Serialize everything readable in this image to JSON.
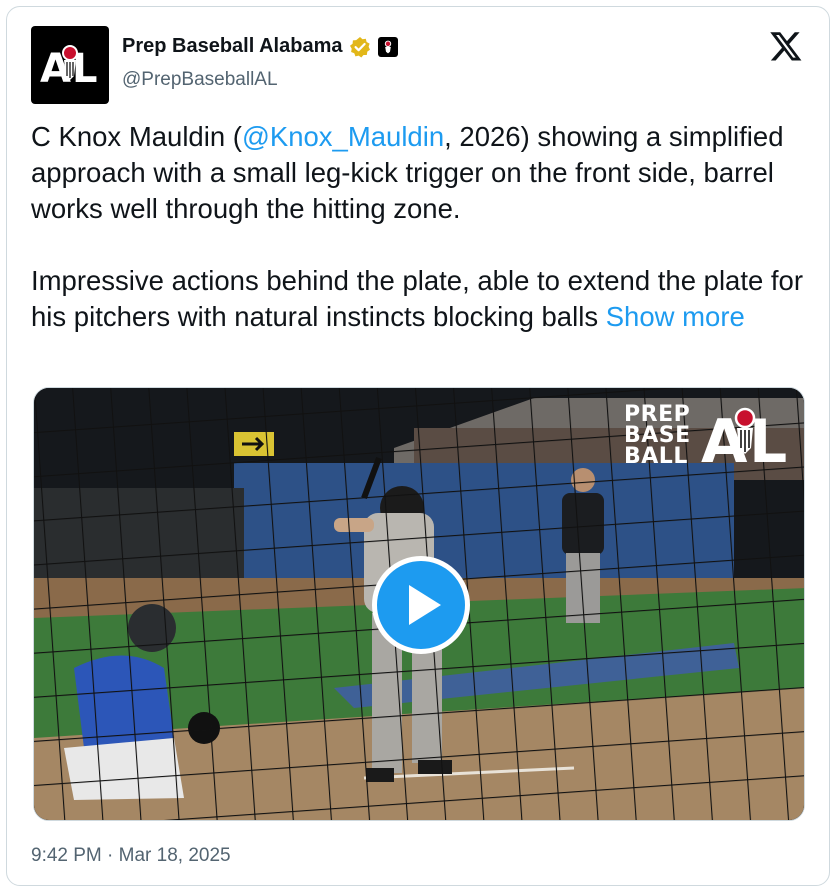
{
  "account": {
    "display_name": "Prep Baseball Alabama",
    "handle": "@PrepBaseballAL",
    "avatar_text": "AL",
    "verified_color": "#e2b719"
  },
  "tweet": {
    "para1_pre": "C Knox Mauldin (",
    "para1_mention": "@Knox_Mauldin",
    "para1_post": ", 2026) showing a simplified approach with a small leg-kick trigger on the front side, barrel works well through the hitting zone.",
    "para2": "Impressive actions behind the plate, able to extend the plate for his pitchers with natural instincts blocking balls",
    "show_more": "Show more",
    "timestamp": "9:42 PM · Mar 18, 2025"
  },
  "media": {
    "type": "video",
    "watermark": {
      "line1": "PREP",
      "line2": "BASE",
      "line3": "BALL",
      "logo_text": "AL"
    }
  },
  "colors": {
    "link": "#1d9bf0",
    "secondary_text": "#536471",
    "border": "#cfd9de"
  },
  "icons": [
    "verified-badge-icon",
    "affiliate-badge-icon",
    "x-logo-icon",
    "play-icon"
  ]
}
